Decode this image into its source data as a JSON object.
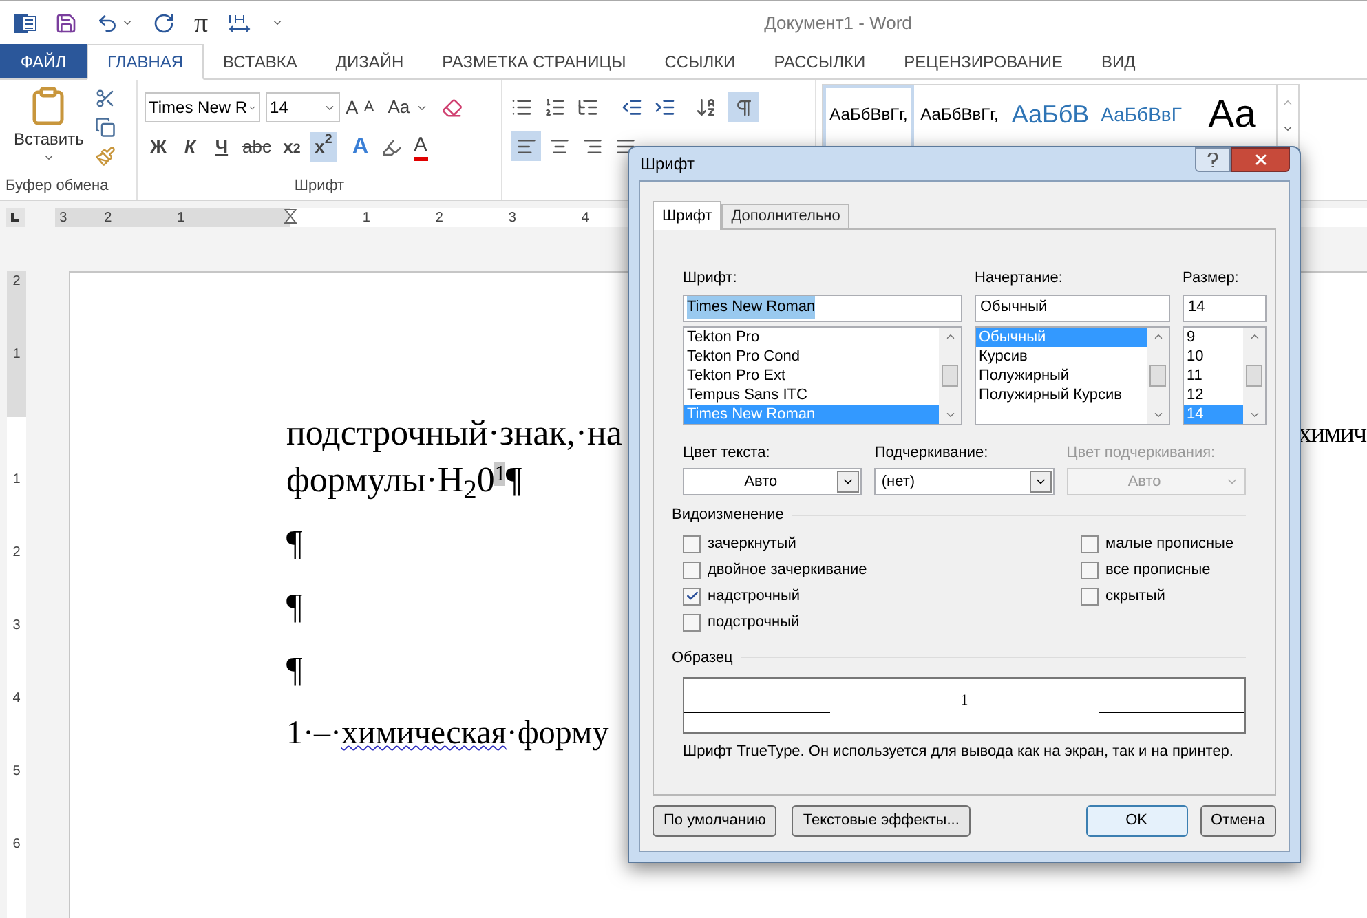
{
  "title_bar": {
    "qat_symbol": "π",
    "title": "Документ1 - Word"
  },
  "ribbon_tabs": [
    {
      "label": "ФАЙЛ",
      "kind": "file",
      "selected": false
    },
    {
      "label": "ГЛАВНАЯ",
      "kind": "tab",
      "selected": true
    },
    {
      "label": "ВСТАВКА",
      "kind": "tab",
      "selected": false
    },
    {
      "label": "ДИЗАЙН",
      "kind": "tab",
      "selected": false
    },
    {
      "label": "РАЗМЕТКА СТРАНИЦЫ",
      "kind": "tab",
      "selected": false
    },
    {
      "label": "ССЫЛКИ",
      "kind": "tab",
      "selected": false
    },
    {
      "label": "РАССЫЛКИ",
      "kind": "tab",
      "selected": false
    },
    {
      "label": "РЕЦЕНЗИРОВАНИЕ",
      "kind": "tab",
      "selected": false
    },
    {
      "label": "ВИД",
      "kind": "tab",
      "selected": false
    }
  ],
  "clipboard": {
    "paste_label": "Вставить",
    "group_label": "Буфер обмена"
  },
  "font_group": {
    "font_name": "Times New R",
    "font_size": "14",
    "grow_label": "A",
    "shrink_label": "A",
    "case_label": "Aa",
    "group_label": "Шрифт",
    "format_buttons": [
      {
        "label": "Ж",
        "kind": "bold",
        "selected": false
      },
      {
        "label": "К",
        "kind": "italic",
        "selected": false
      },
      {
        "label": "Ч",
        "kind": "underline",
        "selected": false
      },
      {
        "label": "abc",
        "kind": "strike",
        "selected": false
      },
      {
        "label": "x$_{2}$",
        "kind": "sub",
        "selected": false
      },
      {
        "label": "x$^{2}$",
        "kind": "sup",
        "selected": true
      }
    ],
    "effect_labels": [
      "A",
      "A"
    ]
  },
  "paragraph": {
    "align": [
      {
        "kind": "left",
        "selected": true
      },
      {
        "kind": "center",
        "selected": false
      },
      {
        "kind": "right",
        "selected": false
      },
      {
        "kind": "justify",
        "selected": false
      }
    ],
    "show_marks": {
      "selected": true
    }
  },
  "styles": [
    {
      "sample": "АаБбВвГг,",
      "kind": "normal",
      "selected": true
    },
    {
      "sample": "АаБбВвГг,",
      "kind": "normal",
      "selected": false
    },
    {
      "sample": "АаБбВ",
      "kind": "heading1",
      "selected": false
    },
    {
      "sample": "АаБбВвГ",
      "kind": "heading2",
      "selected": false
    },
    {
      "sample": "Аа",
      "kind": "title",
      "selected": false
    }
  ],
  "ruler_h": [
    "3",
    "2",
    "1",
    "1",
    "2",
    "3",
    "4"
  ],
  "ruler_v": [
    "2",
    "1",
    "1",
    "2",
    "3",
    "4",
    "5",
    "6"
  ],
  "document": {
    "line1": "подстрочный·знак,·на",
    "line1_right": "химич",
    "line2": "формулы·H$_{2}$0",
    "line2_selection": "1",
    "line2_end": "¶",
    "marks": [
      "¶",
      "¶",
      "¶"
    ],
    "caption": {
      "number": "1·–·",
      "misspelled": "химическая",
      "rest": "·форму"
    }
  },
  "dialog": {
    "title": "Шрифт",
    "tabs": [
      {
        "label": "Шрифт",
        "selected": true
      },
      {
        "label": "Дополнительно",
        "selected": false
      }
    ],
    "font": {
      "label": "Шрифт:",
      "value": "Times New Roman",
      "items": [
        {
          "label": "Tekton Pro",
          "selected": false
        },
        {
          "label": "Tekton Pro Cond",
          "selected": false
        },
        {
          "label": "Tekton Pro Ext",
          "selected": false
        },
        {
          "label": "Tempus Sans ITC",
          "selected": false
        },
        {
          "label": "Times New Roman",
          "selected": true
        }
      ]
    },
    "style": {
      "label": "Начертание:",
      "value": "Обычный",
      "items": [
        {
          "label": "Обычный",
          "selected": true
        },
        {
          "label": "Курсив",
          "selected": false
        },
        {
          "label": "Полужирный",
          "selected": false
        },
        {
          "label": "Полужирный Курсив",
          "selected": false
        }
      ]
    },
    "size": {
      "label": "Размер:",
      "value": "14",
      "items": [
        {
          "label": "9",
          "selected": false
        },
        {
          "label": "10",
          "selected": false
        },
        {
          "label": "11",
          "selected": false
        },
        {
          "label": "12",
          "selected": false
        },
        {
          "label": "14",
          "selected": true
        }
      ]
    },
    "text_color": {
      "label": "Цвет текста:",
      "value": "Авто",
      "disabled": false
    },
    "underline": {
      "label": "Подчеркивание:",
      "value": "(нет)",
      "disabled": false
    },
    "underline_color": {
      "label": "Цвет подчеркивания:",
      "value": "Авто",
      "disabled": true
    },
    "effects": {
      "label": "Видоизменение",
      "left": [
        {
          "label": "зачеркнутый",
          "checked": false
        },
        {
          "label": "двойное зачеркивание",
          "checked": false
        },
        {
          "label": "надстрочный",
          "checked": true
        },
        {
          "label": "подстрочный",
          "checked": false
        }
      ],
      "right": [
        {
          "label": "малые прописные",
          "checked": false
        },
        {
          "label": "все прописные",
          "checked": false
        },
        {
          "label": "скрытый",
          "checked": false
        }
      ]
    },
    "preview": {
      "label": "Образец",
      "sample": "1",
      "note": "Шрифт TrueType. Он используется для вывода как на экран, так и на принтер."
    },
    "buttons": [
      {
        "label": "По умолчанию",
        "kind": "default"
      },
      {
        "label": "Текстовые эффекты...",
        "kind": "default"
      },
      {
        "label": "OK",
        "kind": "primary"
      },
      {
        "label": "Отмена",
        "kind": "default"
      }
    ]
  }
}
